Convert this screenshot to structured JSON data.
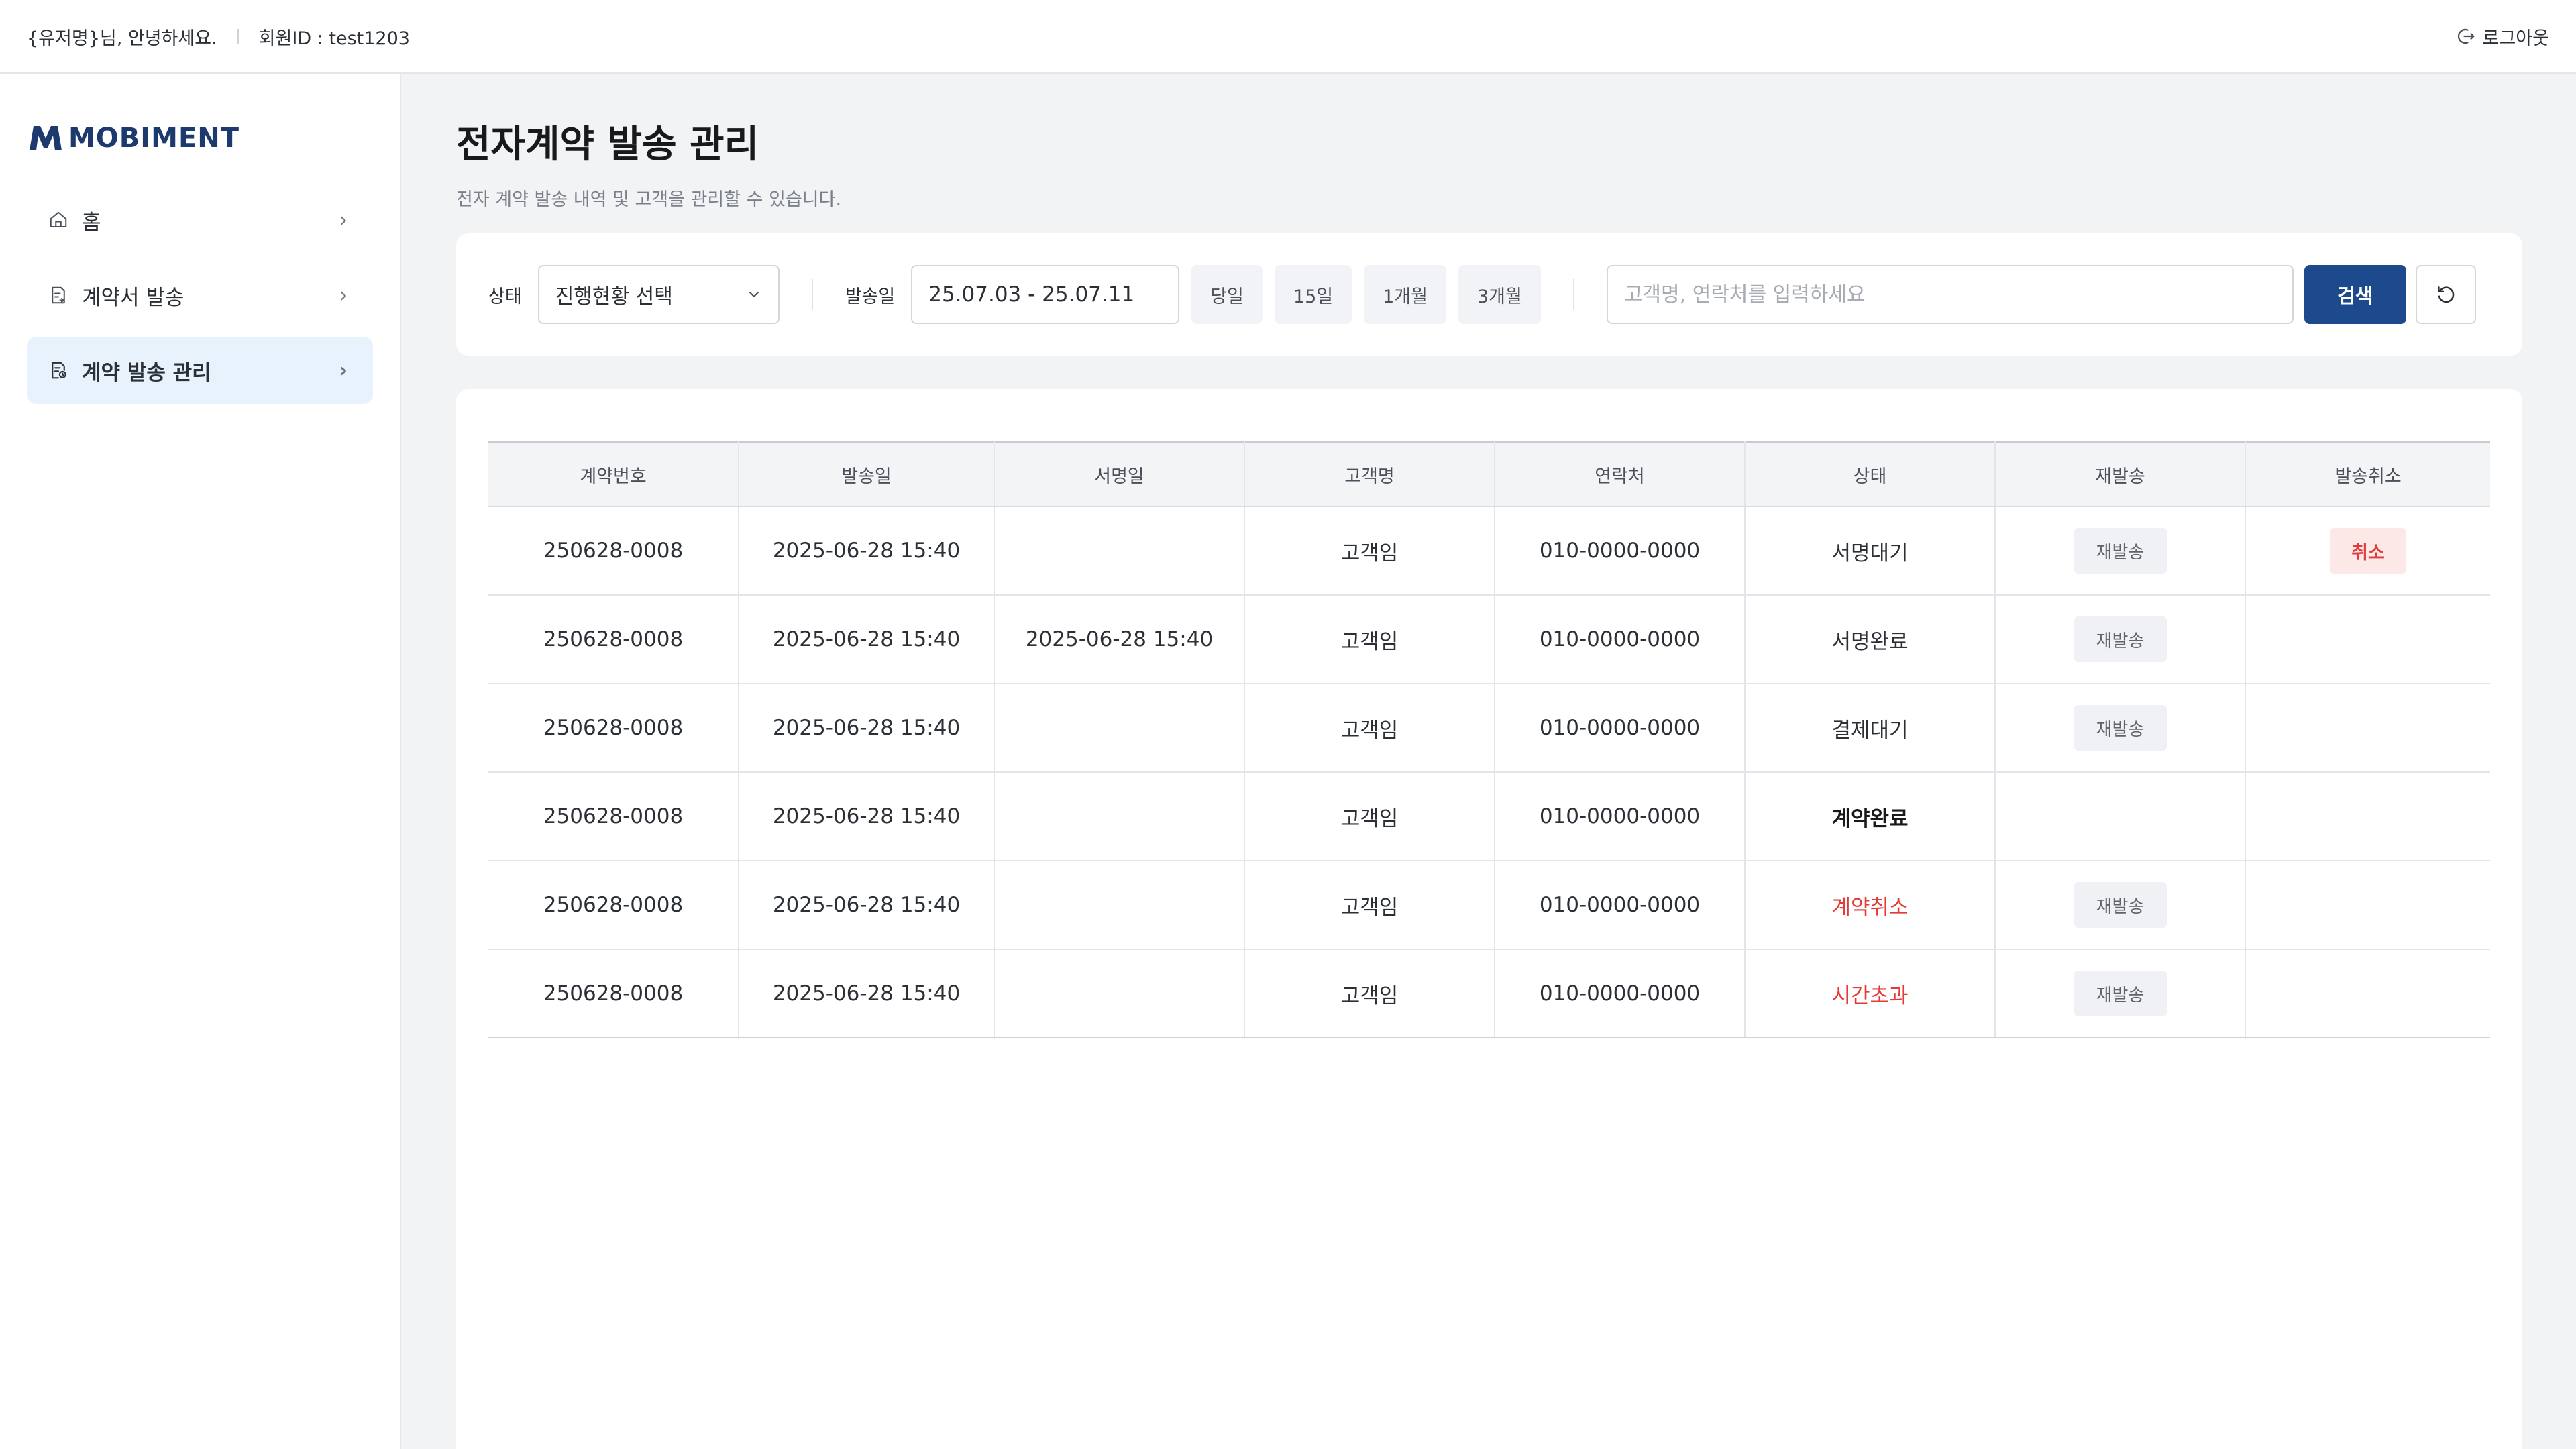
{
  "header": {
    "greeting": "{유저명}님, 안녕하세요.",
    "member_id": "회원ID : test1203",
    "logout_label": "로그아웃"
  },
  "sidebar": {
    "logo_text": "MOBIMENT",
    "items": [
      {
        "label": "홈",
        "icon": "home-icon"
      },
      {
        "label": "계약서 발송",
        "icon": "document-send-icon"
      },
      {
        "label": "계약 발송 관리",
        "icon": "document-manage-icon",
        "active": true
      }
    ]
  },
  "page": {
    "title": "전자계약 발송 관리",
    "subtitle": "전자 계약 발송 내역 및 고객을 관리할 수 있습니다."
  },
  "filters": {
    "status_label": "상태",
    "status_value": "진행현황 선택",
    "date_label": "발송일",
    "date_value": "25.07.03 - 25.07.11",
    "quick_ranges": [
      "당일",
      "15일",
      "1개월",
      "3개월"
    ],
    "search_placeholder": "고객명, 연락처를 입력하세요",
    "search_button": "검색"
  },
  "table": {
    "columns": [
      "계약번호",
      "발송일",
      "서명일",
      "고객명",
      "연락처",
      "상태",
      "재발송",
      "발송취소"
    ],
    "rows": [
      {
        "contract_no": "250628-0008",
        "sent_at": "2025-06-28 15:40",
        "signed_at": "",
        "customer": "고객임",
        "phone": "010-0000-0000",
        "status": "서명대기",
        "status_style": "normal",
        "resend": "재발송",
        "cancel": "취소"
      },
      {
        "contract_no": "250628-0008",
        "sent_at": "2025-06-28 15:40",
        "signed_at": "2025-06-28 15:40",
        "customer": "고객임",
        "phone": "010-0000-0000",
        "status": "서명완료",
        "status_style": "normal",
        "resend": "재발송",
        "cancel": ""
      },
      {
        "contract_no": "250628-0008",
        "sent_at": "2025-06-28 15:40",
        "signed_at": "",
        "customer": "고객임",
        "phone": "010-0000-0000",
        "status": "결제대기",
        "status_style": "normal",
        "resend": "재발송",
        "cancel": ""
      },
      {
        "contract_no": "250628-0008",
        "sent_at": "2025-06-28 15:40",
        "signed_at": "",
        "customer": "고객임",
        "phone": "010-0000-0000",
        "status": "계약완료",
        "status_style": "bold",
        "resend": "",
        "cancel": ""
      },
      {
        "contract_no": "250628-0008",
        "sent_at": "2025-06-28 15:40",
        "signed_at": "",
        "customer": "고객임",
        "phone": "010-0000-0000",
        "status": "계약취소",
        "status_style": "red",
        "resend": "재발송",
        "cancel": ""
      },
      {
        "contract_no": "250628-0008",
        "sent_at": "2025-06-28 15:40",
        "signed_at": "",
        "customer": "고객임",
        "phone": "010-0000-0000",
        "status": "시간초과",
        "status_style": "red",
        "resend": "재발송",
        "cancel": ""
      }
    ]
  },
  "colors": {
    "primary": "#1c4a8c",
    "brand": "#1d3a6e",
    "active_nav_bg": "#e8f2fd",
    "danger": "#e53935",
    "danger_bg": "#fde8e8"
  }
}
